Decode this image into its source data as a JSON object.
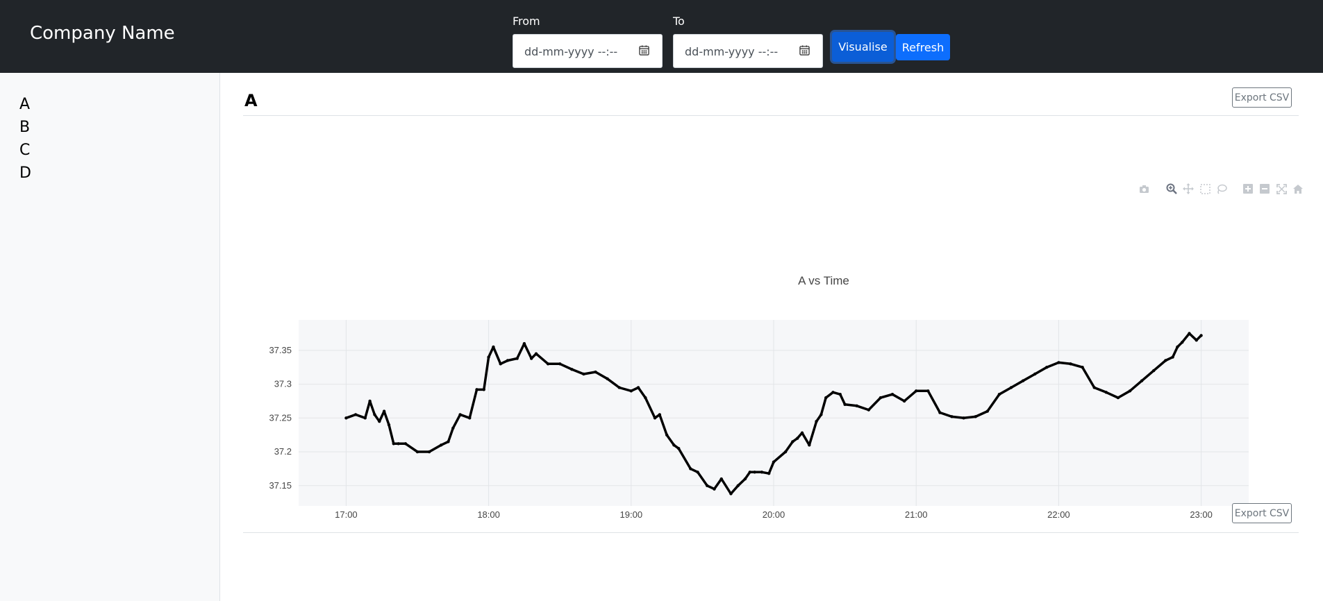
{
  "navbar": {
    "brand": "Company Name",
    "from_label": "From",
    "to_label": "To",
    "from_placeholder": "dd-mm-yyyy --:--",
    "to_placeholder": "dd-mm-yyyy --:--",
    "visualise_label": "Visualise",
    "refresh_label": "Refresh"
  },
  "sidebar": {
    "items": [
      {
        "label": "A"
      },
      {
        "label": "B"
      },
      {
        "label": "C"
      },
      {
        "label": "D"
      }
    ]
  },
  "main": {
    "section_title": "A",
    "export_label": "Export CSV"
  },
  "toolbar": {
    "icons": [
      "camera-icon",
      "zoom-icon",
      "pan-icon",
      "box-select-icon",
      "lasso-icon",
      "zoom-in-icon",
      "zoom-out-icon",
      "autoscale-icon",
      "reset-axes-icon"
    ]
  },
  "chart_data": {
    "type": "line",
    "title": "A vs Time",
    "xlabel": "",
    "ylabel": "",
    "x_ticks": [
      "17:00",
      "18:00",
      "19:00",
      "20:00",
      "21:00",
      "22:00",
      "23:00"
    ],
    "y_ticks": [
      "37.15",
      "37.2",
      "37.25",
      "37.3",
      "37.35"
    ],
    "xlim": [
      "16:40",
      "23:20"
    ],
    "ylim": [
      37.12,
      37.395
    ],
    "grid": true,
    "line_color": "#000000",
    "plot_bg": "#f6f7f9",
    "series": [
      {
        "x": [
          "17:00",
          "17:04",
          "17:08",
          "17:10",
          "17:12",
          "17:14",
          "17:16",
          "17:18",
          "17:20",
          "17:22",
          "17:25",
          "17:30",
          "17:35",
          "17:40",
          "17:43",
          "17:45",
          "17:48",
          "17:52",
          "17:55",
          "17:58",
          "18:00",
          "18:02",
          "18:05",
          "18:08",
          "18:12",
          "18:15",
          "18:18",
          "18:20",
          "18:25",
          "18:30",
          "18:35",
          "18:40",
          "18:45",
          "18:50",
          "18:55",
          "19:00",
          "19:03",
          "19:06",
          "19:10",
          "19:12",
          "19:15",
          "19:18",
          "19:20",
          "19:25",
          "19:28",
          "19:32",
          "19:35",
          "19:38",
          "19:42",
          "19:45",
          "19:48",
          "19:50",
          "19:52",
          "19:55",
          "19:58",
          "20:00",
          "20:05",
          "20:08",
          "20:10",
          "20:12",
          "20:15",
          "20:18",
          "20:20",
          "20:22",
          "20:25",
          "20:28",
          "20:30",
          "20:35",
          "20:40",
          "20:45",
          "20:50",
          "20:55",
          "21:00",
          "21:05",
          "21:10",
          "21:15",
          "21:20",
          "21:25",
          "21:30",
          "21:35",
          "21:40",
          "21:45",
          "21:50",
          "21:55",
          "22:00",
          "22:05",
          "22:10",
          "22:15",
          "22:20",
          "22:25",
          "22:30",
          "22:35",
          "22:40",
          "22:45",
          "22:48",
          "22:50",
          "22:52",
          "22:55",
          "22:58",
          "23:00"
        ],
        "values": [
          37.25,
          37.255,
          37.25,
          37.275,
          37.255,
          37.245,
          37.26,
          37.24,
          37.212,
          37.212,
          37.212,
          37.2,
          37.2,
          37.21,
          37.215,
          37.235,
          37.255,
          37.25,
          37.292,
          37.292,
          37.34,
          37.355,
          37.33,
          37.335,
          37.338,
          37.36,
          37.338,
          37.345,
          37.33,
          37.33,
          37.322,
          37.315,
          37.318,
          37.308,
          37.295,
          37.29,
          37.295,
          37.28,
          37.25,
          37.255,
          37.225,
          37.21,
          37.205,
          37.175,
          37.17,
          37.15,
          37.145,
          37.16,
          37.138,
          37.15,
          37.16,
          37.17,
          37.17,
          37.17,
          37.168,
          37.185,
          37.2,
          37.215,
          37.22,
          37.228,
          37.21,
          37.245,
          37.255,
          37.28,
          37.288,
          37.285,
          37.27,
          37.268,
          37.262,
          37.28,
          37.285,
          37.275,
          37.29,
          37.29,
          37.258,
          37.252,
          37.25,
          37.252,
          37.26,
          37.285,
          37.295,
          37.305,
          37.315,
          37.325,
          37.332,
          37.33,
          37.325,
          37.295,
          37.288,
          37.28,
          37.29,
          37.305,
          37.32,
          37.335,
          37.34,
          37.355,
          37.362,
          37.375,
          37.365,
          37.372
        ]
      }
    ]
  }
}
